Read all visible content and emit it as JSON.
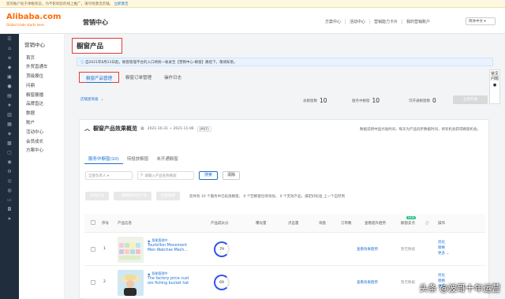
{
  "topbar": {
    "notice": "您的账户处于休眠状态，为不影响您的线上推广，请尽快激活店铺。",
    "link": "立即激活"
  },
  "header": {
    "logo": "Alibaba.com",
    "logo_sub": "Global trade starts here.",
    "site_title": "营销中心",
    "nav": [
      "方案中心",
      "活动中心",
      "营销能力卡片",
      "我的营销账户"
    ],
    "lang": "简体中文"
  },
  "sidenav": {
    "title": "营销中心",
    "items": [
      "首页",
      "外贸直通车",
      "顶级展位",
      "问鼎",
      "橱窗展播",
      "品牌直达",
      "数据",
      "账户",
      "活动中心",
      "会员成长",
      "方案中心"
    ]
  },
  "main": {
    "page_title": "橱窗产品",
    "notice": "自2021年8月23日起，橱窗管理平台的入口将统一收录至【营销中心-橱窗】路径下，敬请知悉。",
    "tabs": [
      "橱窗产品管理",
      "橱窗订单管理",
      "操作日志"
    ],
    "help_link": "帮助",
    "stats": {
      "link": "店铺星等级",
      "total_label": "总橱窗数",
      "total": "10",
      "service_label": "服务中橱窗",
      "service": "10",
      "available_label": "可开通橱窗数",
      "available": "0",
      "btn": "立即开通"
    },
    "panel": {
      "title": "橱窗产品效果概览",
      "date": "2021-10-31 ~ 2021-11-06",
      "tz": "(PST)",
      "note": "数据说明中国大陆时间，每天为产品同步数据时间，将有机会获得橱窗机会。",
      "subtabs": [
        "服务中橱窗(10)",
        "待投放橱窗",
        "未开通橱窗"
      ],
      "filter": {
        "select": "全部负责人",
        "search_placeholder": "请输入产品名称搜索",
        "search_btn": "搜索",
        "clear_btn": "清除"
      },
      "actions": [
        "添加产品",
        "一键替换失效产品",
        "批量替换"
      ],
      "action_info": "您共有 10 个服务中已投放橱窗， 0 个空橱窗位待添加， 0 个无效产品，满足好标准 上一个自然周",
      "columns": [
        "序号",
        "产品信息",
        "产品成长分",
        "曝光量",
        "点击量",
        "询盘",
        "订单数",
        "查看提升趋势",
        "橱窗卖点",
        "操作"
      ],
      "col_badge": "NEW",
      "rows": [
        {
          "no": "1",
          "badge": "智能管理中",
          "title": "Tourbillon Movement Men Watches Mech...",
          "score": "79",
          "trend": "查看效果趋势",
          "point": "暂无数据",
          "ops": [
            "优化",
            "替换",
            "更多"
          ]
        },
        {
          "no": "2",
          "badge": "智能管理中",
          "title": "The factory price cust om fishing bucket hat",
          "score": "69",
          "trend": "查看效果趋势",
          "point": "暂无数据",
          "ops": [
            "优化",
            "替换",
            "更多"
          ]
        }
      ]
    }
  },
  "help_float": "常见问题",
  "watermark": "头条 @波哥十年运营"
}
